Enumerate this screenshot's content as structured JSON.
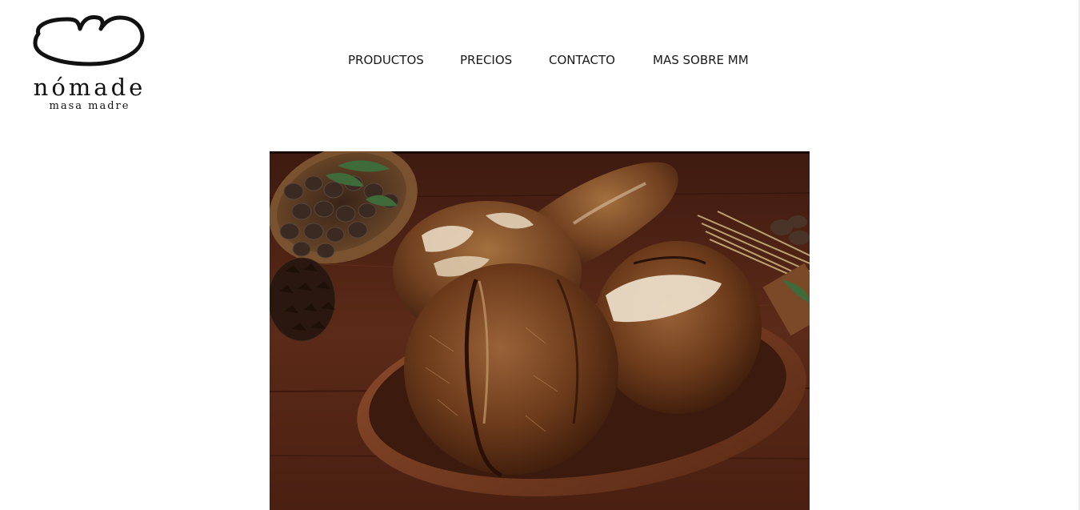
{
  "brand": {
    "name": "nómade",
    "tagline": "masa madre"
  },
  "nav": {
    "items": [
      {
        "label": "PRODUCTOS"
      },
      {
        "label": "PRECIOS"
      },
      {
        "label": "CONTACTO"
      },
      {
        "label": "MAS SOBRE MM"
      }
    ]
  },
  "hero": {
    "image": "sourdough-loaves-on-wooden-table"
  },
  "colors": {
    "background": "#ffffff",
    "text": "#1a1a1a",
    "wood": "#5a2a1a"
  }
}
